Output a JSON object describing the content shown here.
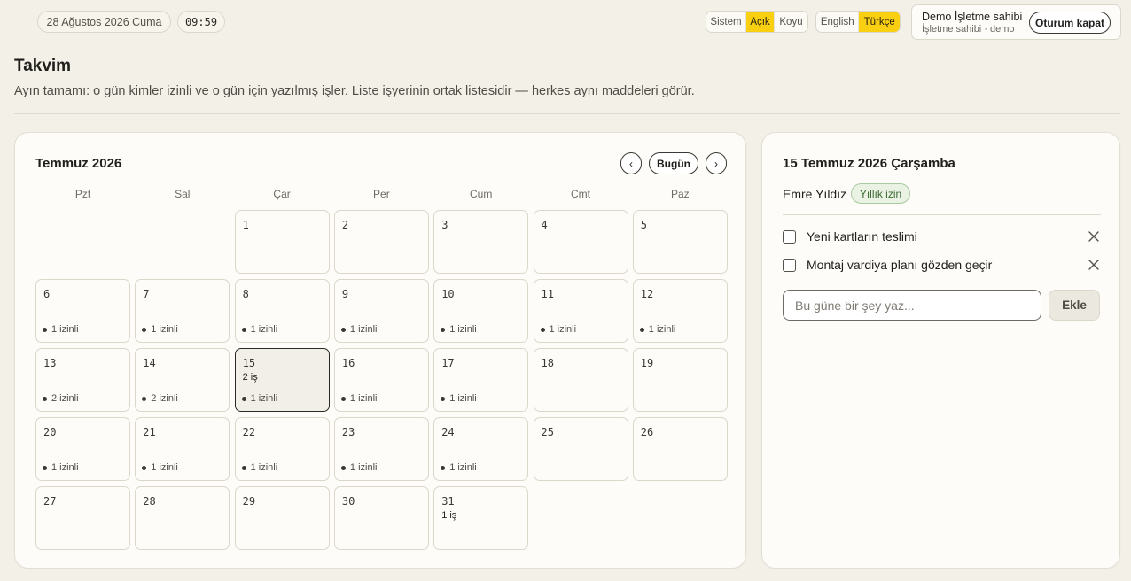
{
  "topbar": {
    "date": "28 Ağustos 2026 Cuma",
    "time": "09:59",
    "theme_options": [
      {
        "label": "Sistem",
        "active": false
      },
      {
        "label": "Açık",
        "active": true
      },
      {
        "label": "Koyu",
        "active": false
      }
    ],
    "language_options": [
      {
        "label": "English",
        "active": false
      },
      {
        "label": "Türkçe",
        "active": true
      }
    ],
    "user": {
      "name": "Demo İşletme sahibi",
      "role": "İşletme sahibi · demo",
      "logout_label": "Oturum kapat"
    }
  },
  "header": {
    "title": "Takvim",
    "subtitle": "Ayın tamamı: o gün kimler izinli ve o gün için yazılmış işler. Liste işyerinin ortak listesidir — herkes aynı maddeleri görür."
  },
  "calendar": {
    "month_label": "Temmuz 2026",
    "prev_label": "‹",
    "today_label": "Bugün",
    "next_label": "›",
    "weekdays": [
      "Pzt",
      "Sal",
      "Çar",
      "Per",
      "Cum",
      "Cmt",
      "Paz"
    ],
    "leading_empty": 2,
    "selected_day": 15,
    "days": [
      {
        "day": "1",
        "tasks": "",
        "leave": ""
      },
      {
        "day": "2",
        "tasks": "",
        "leave": ""
      },
      {
        "day": "3",
        "tasks": "",
        "leave": ""
      },
      {
        "day": "4",
        "tasks": "",
        "leave": ""
      },
      {
        "day": "5",
        "tasks": "",
        "leave": ""
      },
      {
        "day": "6",
        "tasks": "",
        "leave": "1 izinli"
      },
      {
        "day": "7",
        "tasks": "",
        "leave": "1 izinli"
      },
      {
        "day": "8",
        "tasks": "",
        "leave": "1 izinli"
      },
      {
        "day": "9",
        "tasks": "",
        "leave": "1 izinli"
      },
      {
        "day": "10",
        "tasks": "",
        "leave": "1 izinli"
      },
      {
        "day": "11",
        "tasks": "",
        "leave": "1 izinli"
      },
      {
        "day": "12",
        "tasks": "",
        "leave": "1 izinli"
      },
      {
        "day": "13",
        "tasks": "",
        "leave": "2 izinli"
      },
      {
        "day": "14",
        "tasks": "",
        "leave": "2 izinli"
      },
      {
        "day": "15",
        "tasks": "2 iş",
        "leave": "1 izinli"
      },
      {
        "day": "16",
        "tasks": "",
        "leave": "1 izinli"
      },
      {
        "day": "17",
        "tasks": "",
        "leave": "1 izinli"
      },
      {
        "day": "18",
        "tasks": "",
        "leave": ""
      },
      {
        "day": "19",
        "tasks": "",
        "leave": ""
      },
      {
        "day": "20",
        "tasks": "",
        "leave": "1 izinli"
      },
      {
        "day": "21",
        "tasks": "",
        "leave": "1 izinli"
      },
      {
        "day": "22",
        "tasks": "",
        "leave": "1 izinli"
      },
      {
        "day": "23",
        "tasks": "",
        "leave": "1 izinli"
      },
      {
        "day": "24",
        "tasks": "",
        "leave": "1 izinli"
      },
      {
        "day": "25",
        "tasks": "",
        "leave": ""
      },
      {
        "day": "26",
        "tasks": "",
        "leave": ""
      },
      {
        "day": "27",
        "tasks": "",
        "leave": ""
      },
      {
        "day": "28",
        "tasks": "",
        "leave": ""
      },
      {
        "day": "29",
        "tasks": "",
        "leave": ""
      },
      {
        "day": "30",
        "tasks": "",
        "leave": ""
      },
      {
        "day": "31",
        "tasks": "1 iş",
        "leave": ""
      }
    ]
  },
  "day_panel": {
    "title": "15 Temmuz 2026 Çarşamba",
    "person": "Emre Yıldız",
    "leave_type": "Yıllık izin",
    "tasks": [
      {
        "text": "Yeni kartların teslimi",
        "done": false
      },
      {
        "text": "Montaj vardiya planı gözden geçir",
        "done": false
      }
    ],
    "input_placeholder": "Bu güne bir şey yaz...",
    "add_label": "Ekle"
  },
  "colors": {
    "accent": "#f9cf12",
    "background": "#f3f0e8",
    "panel": "#fdfcf8",
    "leave_badge_bg": "#eaf2e4",
    "leave_badge_text": "#3d6a34"
  }
}
